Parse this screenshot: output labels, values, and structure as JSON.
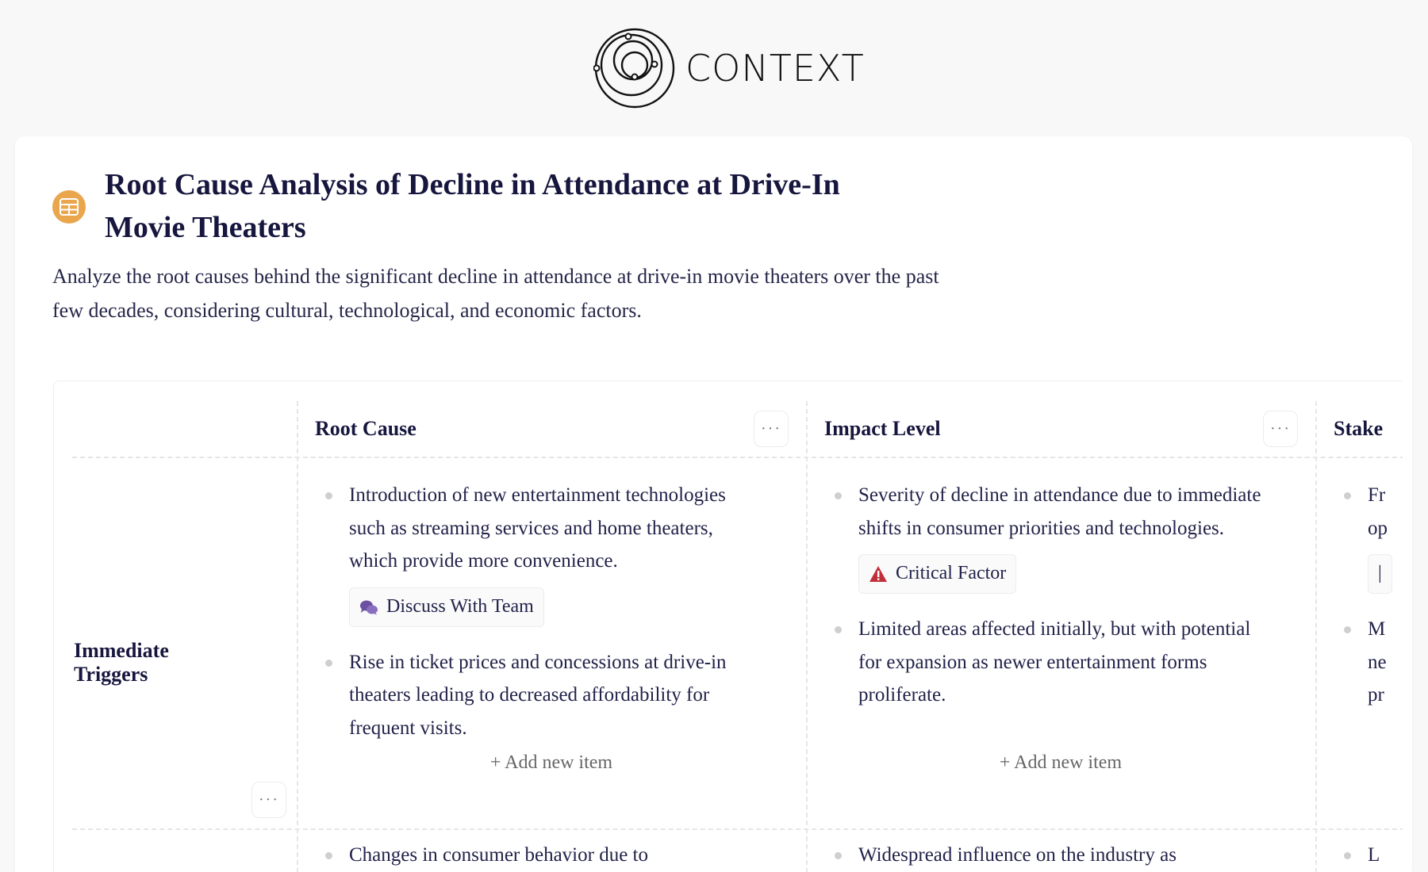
{
  "brand": {
    "name": "CONTEXT"
  },
  "page": {
    "icon": "table-grid-icon",
    "title": "Root Cause Analysis of Decline in Attendance at Drive-In Movie Theaters",
    "description": "Analyze the root causes behind the significant decline in attendance at drive-in movie theaters over the past few decades, considering cultural, technological, and economic factors."
  },
  "colors": {
    "accent": "#e9a64c",
    "discuss": "#6b4fa0",
    "critical": "#c0303a",
    "text": "#16163e"
  },
  "table": {
    "columns": [
      {
        "label": "Root Cause",
        "menu": "···"
      },
      {
        "label": "Impact Level",
        "menu": "···"
      },
      {
        "label": "Stake"
      }
    ],
    "add_label": "Add new item",
    "rows": [
      {
        "label": "Immediate Triggers",
        "menu": "···",
        "cells": [
          {
            "items": [
              {
                "text": "Introduction of new entertainment technologies such as streaming services and home theaters, which provide more convenience.",
                "tag": {
                  "label": "Discuss With Team",
                  "icon": "chat-bubbles-icon"
                }
              },
              {
                "text": "Rise in ticket prices and concessions at drive-in theaters leading to decreased affordability for frequent visits."
              }
            ]
          },
          {
            "items": [
              {
                "text": "Severity of decline in attendance due to immediate shifts in consumer priorities and technologies.",
                "tag": {
                  "label": "Critical Factor",
                  "icon": "warning-triangle-icon"
                }
              },
              {
                "text": "Limited areas affected initially, but with potential for expansion as newer entertainment forms proliferate."
              }
            ]
          },
          {
            "items": [
              {
                "text": "Fr op",
                "tag": {
                  "label": "|"
                }
              },
              {
                "text": "M ne pr"
              }
            ]
          }
        ]
      },
      {
        "cells": [
          {
            "items": [
              {
                "text": "Changes in consumer behavior due to"
              }
            ]
          },
          {
            "items": [
              {
                "text": "Widespread influence on the industry as"
              }
            ]
          },
          {
            "items": [
              {
                "text": "L"
              }
            ]
          }
        ]
      }
    ]
  }
}
